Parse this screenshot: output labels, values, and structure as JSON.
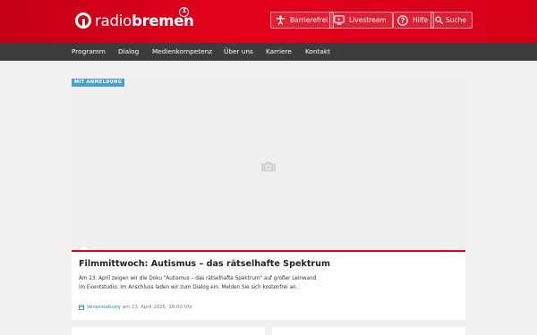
{
  "header": {
    "logo_light": "radio",
    "logo_bold": "bremen",
    "buttons": [
      {
        "label": "Barrierefrei",
        "icon": "accessibility-icon"
      },
      {
        "label": "Livestream",
        "icon": "tv-icon"
      },
      {
        "label": "Hilfe",
        "icon": "help-icon"
      },
      {
        "label": "Suche",
        "icon": "search-icon"
      }
    ]
  },
  "nav": {
    "items": [
      "Programm",
      "Dialog",
      "Medienkompetenz",
      "Über uns",
      "Karriere",
      "Kontakt"
    ]
  },
  "event": {
    "badge": "MIT ANMELDUNG",
    "title": "Filmmittwoch: Autismus – das rätselhafte Spektrum",
    "teaser": "Am 23. April zeigen wir die Doku \"Autismus – das rätselhafte Spektrum\" auf großer Leinwand im Eventstudio. Im Anschluss laden wir zum Dialog ein. Melden Sie sich kostenfrei an.",
    "meta_type": "Veranstaltung",
    "meta_date": "am 23. April 2025, 18:00 Uhr"
  },
  "colors": {
    "brand_red": "#e3001b",
    "nav_bg": "#3c3c3c",
    "badge_blue": "#4aa0c9",
    "link_blue": "#2c82c9"
  }
}
